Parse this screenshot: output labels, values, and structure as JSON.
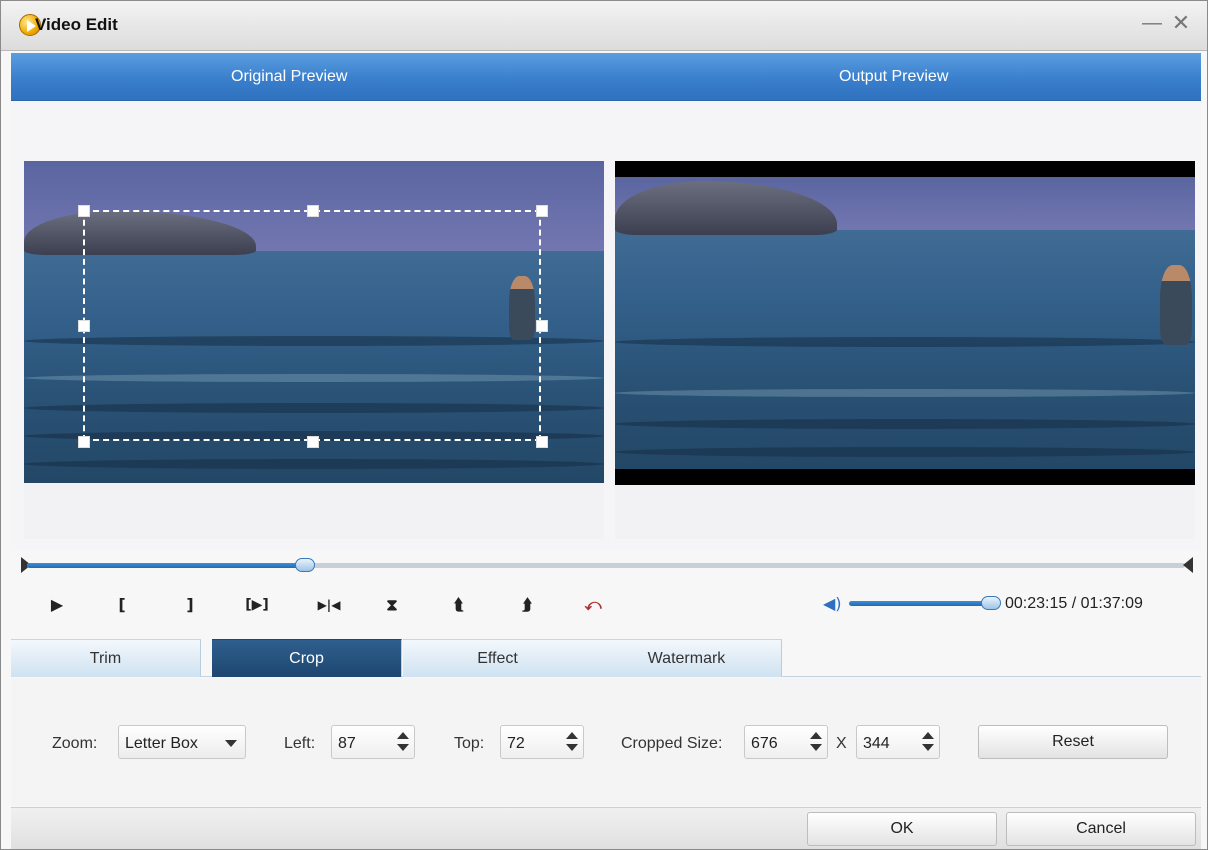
{
  "window": {
    "title": "Video Edit",
    "minimize_glyph": "—",
    "close_glyph": "✕"
  },
  "preview": {
    "original_label": "Original Preview",
    "output_label": "Output Preview"
  },
  "playback": {
    "progress": 0.24,
    "volume": 0.97,
    "time_text": "00:23:15 / 01:37:09",
    "icons": [
      "play-icon",
      "mark-in-icon",
      "mark-out-icon",
      "play-segment-icon",
      "go-to-end-icon",
      "split-icon",
      "rotate-left-icon",
      "rotate-right-icon",
      "undo-icon"
    ],
    "glyphs": {
      "play": "▶",
      "mark_in": "[",
      "mark_out": "]",
      "play_segment": "[▶]",
      "go_to_end": "▶|◀",
      "split": "⧗",
      "rotate_left": "⮬",
      "rotate_right": "⮭",
      "undo": "⤺",
      "volume": "◀)"
    }
  },
  "tabs": [
    {
      "label": "Trim",
      "active": false
    },
    {
      "label": "Crop",
      "active": true
    },
    {
      "label": "Effect",
      "active": false
    },
    {
      "label": "Watermark",
      "active": false
    }
  ],
  "crop": {
    "zoom_label": "Zoom:",
    "zoom_value": "Letter Box",
    "left_label": "Left:",
    "left_value": "87",
    "top_label": "Top:",
    "top_value": "72",
    "size_label": "Cropped Size:",
    "width_value": "676",
    "x_label": "X",
    "height_value": "344",
    "reset_label": "Reset"
  },
  "footer": {
    "ok_label": "OK",
    "cancel_label": "Cancel"
  },
  "colors": {
    "accent": "#3a7fcc",
    "active_tab": "#2f5f8e"
  }
}
